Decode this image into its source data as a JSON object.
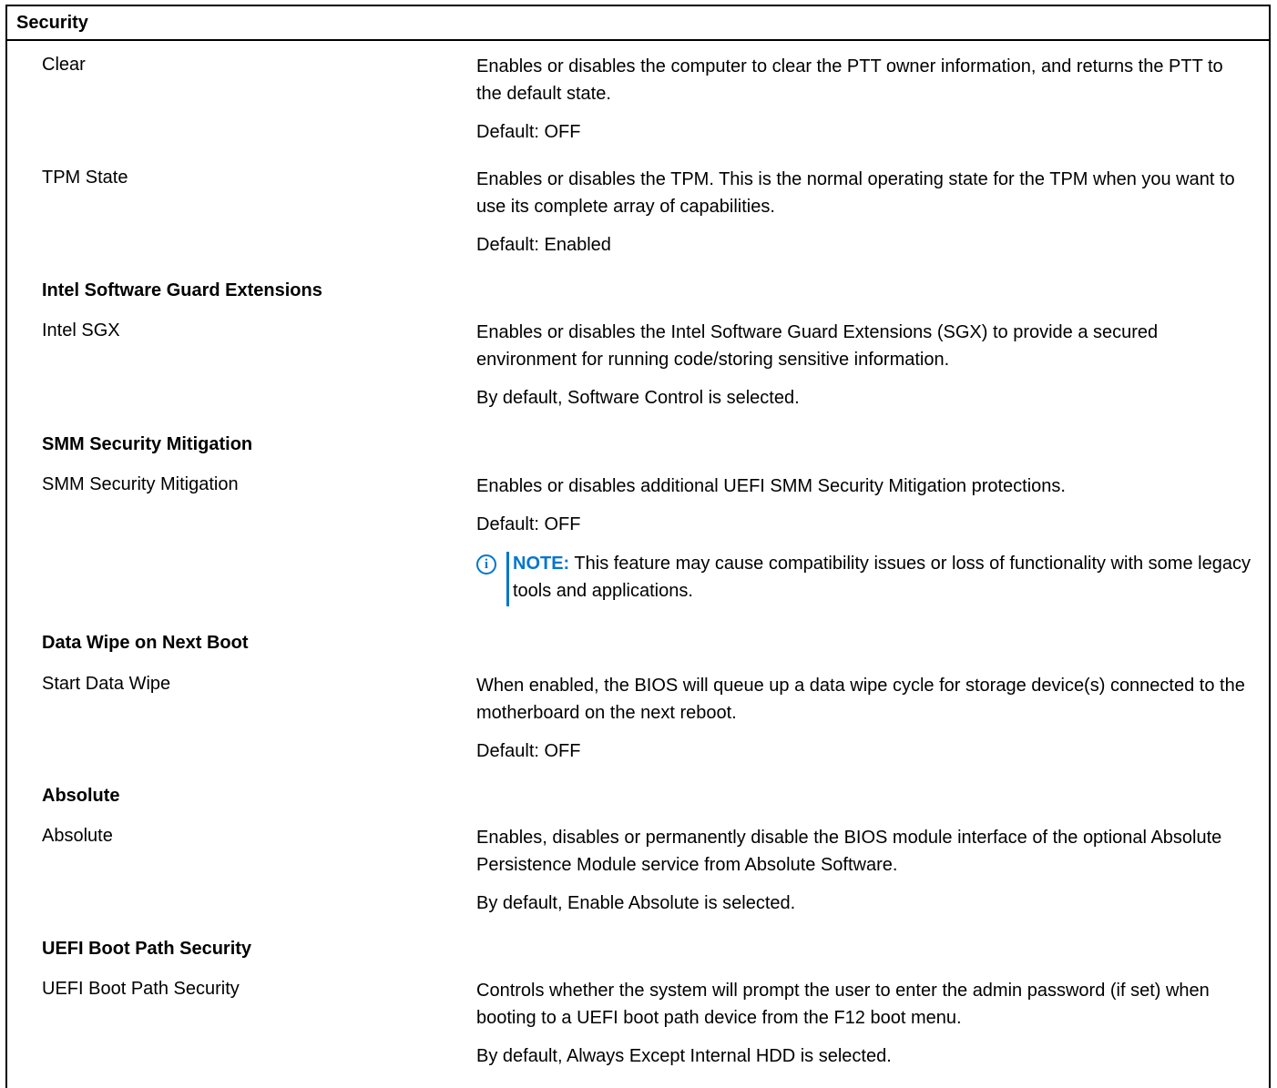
{
  "table": {
    "title": "Security"
  },
  "rows": {
    "clear": {
      "label": "Clear",
      "desc": "Enables or disables the computer to clear the PTT owner information, and returns the PTT to the default state.",
      "default": "Default: OFF"
    },
    "tpm_state": {
      "label": "TPM State",
      "desc": "Enables or disables the TPM. This is the normal operating state for the TPM when you want to use its complete array of capabilities.",
      "default": "Default: Enabled"
    },
    "sgx_heading": "Intel Software Guard Extensions",
    "intel_sgx": {
      "label": "Intel SGX",
      "desc": "Enables or disables the Intel Software Guard Extensions (SGX) to provide a secured environment for running code/storing sensitive information.",
      "default": "By default, Software Control is selected."
    },
    "smm_heading": "SMM Security Mitigation",
    "smm": {
      "label": "SMM Security Mitigation",
      "desc": "Enables or disables additional UEFI SMM Security Mitigation protections.",
      "default": "Default: OFF",
      "note_label": "NOTE:",
      "note_text": " This feature may cause compatibility issues or loss of functionality with some legacy tools and applications."
    },
    "wipe_heading": "Data Wipe on Next Boot",
    "start_data_wipe": {
      "label": "Start Data Wipe",
      "desc": "When enabled, the BIOS will queue up a data wipe cycle for storage device(s) connected to the motherboard on the next reboot.",
      "default": "Default: OFF"
    },
    "absolute_heading": "Absolute",
    "absolute": {
      "label": "Absolute",
      "desc": "Enables, disables or permanently disable the BIOS module interface of the optional Absolute Persistence Module service from Absolute Software.",
      "default": "By default, Enable Absolute is selected."
    },
    "uefi_heading": "UEFI Boot Path Security",
    "uefi_boot_path": {
      "label": "UEFI Boot Path Security",
      "desc": "Controls whether the system will prompt the user to enter the admin password (if set) when booting to a UEFI boot path device from the F12 boot menu.",
      "default": "By default, Always Except Internal HDD is selected."
    }
  },
  "icons": {
    "note_icon": "info-circle",
    "note_glyph": "i"
  },
  "colors": {
    "accent": "#0076ce",
    "text": "#000000",
    "border": "#000000"
  }
}
